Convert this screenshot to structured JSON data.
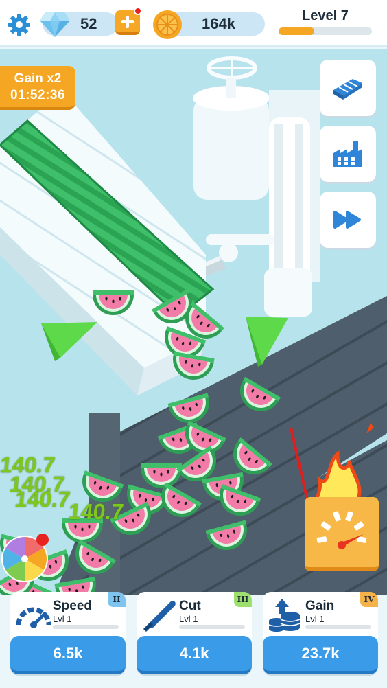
{
  "header": {
    "gems": "52",
    "coins": "164k",
    "level_label": "Level 7",
    "level_progress": 0.38,
    "icons": [
      "gear-icon",
      "diamond-icon",
      "plus-icon",
      "orange-coin-icon"
    ]
  },
  "scene": {
    "gain_badge": {
      "title": "Gain x2",
      "timer": "01:52:36"
    },
    "side_buttons": [
      "conveyor-icon",
      "factory-icon",
      "fast-forward-icon"
    ],
    "floating_numbers": [
      "140.7",
      "140.7",
      "140.7",
      "140.7"
    ],
    "boost_icon": "speedometer-icon"
  },
  "upgrades": [
    {
      "title": "Speed",
      "level": "Lvl 1",
      "tier": "II",
      "cost": "6.5k",
      "icon": "speedometer-icon",
      "tier_color": "#7fc3ef"
    },
    {
      "title": "Cut",
      "level": "Lvl 1",
      "tier": "III",
      "cost": "4.1k",
      "icon": "knife-icon",
      "tier_color": "#9ee06d"
    },
    {
      "title": "Gain",
      "level": "Lvl 1",
      "tier": "IV",
      "cost": "23.7k",
      "icon": "coin-stack-icon",
      "tier_color": "#f5b14a"
    }
  ],
  "colors": {
    "accent_orange": "#f5a623",
    "button_blue": "#3a9ce8",
    "watermelon_green": "#3fbf6a",
    "watermelon_flesh": "#f27ba7"
  }
}
